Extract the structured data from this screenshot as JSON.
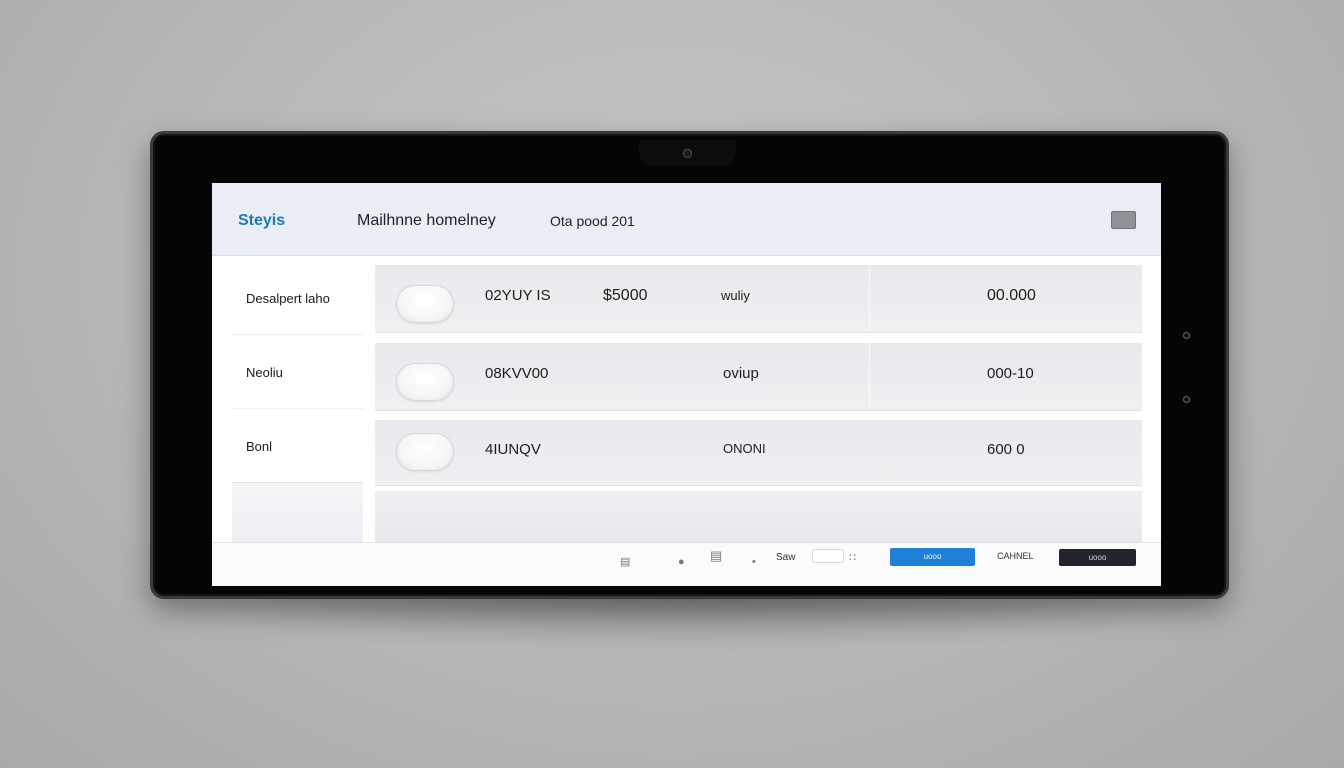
{
  "header": {
    "brand": "Steyis",
    "title": "Mailhnne homelney",
    "date": "Ota pood 201"
  },
  "sidebar": {
    "items": [
      {
        "label": "Desalpert laho"
      },
      {
        "label": "Neoliu"
      },
      {
        "label": "Bonl"
      }
    ]
  },
  "table": {
    "rows": [
      {
        "code": "02YUY IS",
        "amount": "$5000",
        "status": "wuliy",
        "value": "00.000"
      },
      {
        "code": "08KVV00",
        "amount": "",
        "status": "oviup",
        "value": "000-10"
      },
      {
        "code": "4IUNQV",
        "amount": "",
        "status": "ONONI",
        "value": "600 0"
      }
    ]
  },
  "toolbar": {
    "save_label": "Saw",
    "primary_label": "uooo",
    "cancel_label": "CAHNEL",
    "dark_label": "uooo"
  },
  "colors": {
    "brand": "#1f79b8",
    "primary_button": "#1e80d6",
    "dark_button": "#22252b",
    "header_bg": "#eaedf6"
  }
}
